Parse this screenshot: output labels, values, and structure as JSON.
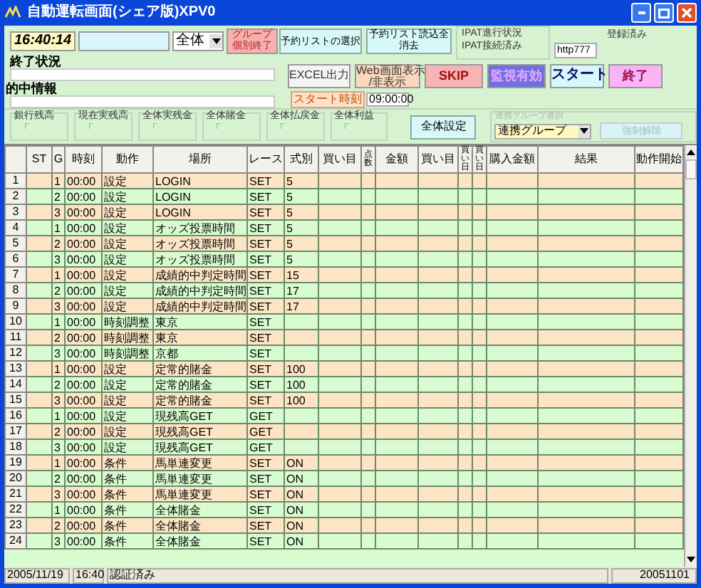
{
  "window": {
    "title": "自動運転画面(シェア版)XPV0"
  },
  "clock": "16:40:14",
  "group_select": {
    "value": "全体"
  },
  "group_end_button": "グループ個別終了",
  "end_status": {
    "label": "終了状況"
  },
  "hit_info": {
    "label": "的中情報"
  },
  "reserve_select_button": "予約リストの選択",
  "reserve_clear_button": "予約リスト読込全消去",
  "ipat": {
    "title": "IPAT進行状況",
    "status": "IPAT接続済み",
    "url": "http777"
  },
  "registered": "登録済み",
  "action_buttons": [
    {
      "label": "EXCEL出力",
      "kind": "plain"
    },
    {
      "label": "Web画面表示\n/非表示",
      "kind": "peach"
    },
    {
      "label": "SKIP",
      "kind": "pink"
    },
    {
      "label": "監視有効",
      "kind": "purple"
    },
    {
      "label": "スタート",
      "kind": "cyan"
    },
    {
      "label": "終了",
      "kind": "violet"
    }
  ],
  "start_time": {
    "label": "スタート時刻",
    "value": "09:00:00"
  },
  "totals": [
    {
      "label": "銀行残高",
      "value": "「"
    },
    {
      "label": "現在実残高",
      "value": "「"
    },
    {
      "label": "全体実残金",
      "value": "「"
    },
    {
      "label": "全体賭金",
      "value": "「"
    },
    {
      "label": "全体払戻金",
      "value": "「"
    },
    {
      "label": "全体利益",
      "value": "「"
    }
  ],
  "all_settings_button": "全体設定",
  "link_group": {
    "title": "連携グループ選択",
    "select": "連携グループ",
    "button": "強制解除",
    "disabled": true
  },
  "table": {
    "columns": [
      "ST",
      "G",
      "時刻",
      "動作",
      "場所",
      "レース",
      "式別",
      "買い目",
      "点数",
      "金額",
      "買い目",
      "買い日",
      "買い日",
      "購入金額",
      "結果",
      "動作開始"
    ],
    "rows": [
      {
        "header": "1",
        "cells": [
          "",
          "1",
          "00:00",
          "設定",
          "LOGIN",
          "SET",
          "5"
        ]
      },
      {
        "header": "2",
        "cells": [
          "",
          "2",
          "00:00",
          "設定",
          "LOGIN",
          "SET",
          "5"
        ]
      },
      {
        "header": "3",
        "cells": [
          "",
          "3",
          "00:00",
          "設定",
          "LOGIN",
          "SET",
          "5"
        ]
      },
      {
        "header": "4",
        "cells": [
          "",
          "1",
          "00:00",
          "設定",
          "オッズ投票時間",
          "SET",
          "5"
        ]
      },
      {
        "header": "5",
        "cells": [
          "",
          "2",
          "00:00",
          "設定",
          "オッズ投票時間",
          "SET",
          "5"
        ]
      },
      {
        "header": "6",
        "cells": [
          "",
          "3",
          "00:00",
          "設定",
          "オッズ投票時間",
          "SET",
          "5"
        ]
      },
      {
        "header": "7",
        "cells": [
          "",
          "1",
          "00:00",
          "設定",
          "成績的中判定時間",
          "SET",
          "15"
        ]
      },
      {
        "header": "8",
        "cells": [
          "",
          "2",
          "00:00",
          "設定",
          "成績的中判定時間",
          "SET",
          "17"
        ]
      },
      {
        "header": "9",
        "cells": [
          "",
          "3",
          "00:00",
          "設定",
          "成績的中判定時間",
          "SET",
          "17"
        ]
      },
      {
        "header": "10",
        "cells": [
          "",
          "1",
          "00:00",
          "時刻調整",
          "東京",
          "SET"
        ]
      },
      {
        "header": "11",
        "cells": [
          "",
          "2",
          "00:00",
          "時刻調整",
          "東京",
          "SET"
        ]
      },
      {
        "header": "12",
        "cells": [
          "",
          "3",
          "00:00",
          "時刻調整",
          "京都",
          "SET"
        ]
      },
      {
        "header": "13",
        "cells": [
          "",
          "1",
          "00:00",
          "設定",
          "定常的賭金",
          "SET",
          "100"
        ]
      },
      {
        "header": "14",
        "cells": [
          "",
          "2",
          "00:00",
          "設定",
          "定常的賭金",
          "SET",
          "100"
        ]
      },
      {
        "header": "15",
        "cells": [
          "",
          "3",
          "00:00",
          "設定",
          "定常的賭金",
          "SET",
          "100"
        ]
      },
      {
        "header": "16",
        "cells": [
          "",
          "1",
          "00:00",
          "設定",
          "現残高GET",
          "GET"
        ]
      },
      {
        "header": "17",
        "cells": [
          "",
          "2",
          "00:00",
          "設定",
          "現残高GET",
          "GET"
        ]
      },
      {
        "header": "18",
        "cells": [
          "",
          "3",
          "00:00",
          "設定",
          "現残高GET",
          "GET"
        ]
      },
      {
        "header": "19",
        "cells": [
          "",
          "1",
          "00:00",
          "条件",
          "馬単連変更",
          "SET",
          "ON"
        ]
      },
      {
        "header": "20",
        "cells": [
          "",
          "2",
          "00:00",
          "条件",
          "馬単連変更",
          "SET",
          "ON"
        ]
      },
      {
        "header": "21",
        "cells": [
          "",
          "3",
          "00:00",
          "条件",
          "馬単連変更",
          "SET",
          "ON"
        ]
      },
      {
        "header": "22",
        "cells": [
          "",
          "1",
          "00:00",
          "条件",
          "全体賭金",
          "SET",
          "ON"
        ]
      },
      {
        "header": "23",
        "cells": [
          "",
          "2",
          "00:00",
          "条件",
          "全体賭金",
          "SET",
          "ON"
        ]
      },
      {
        "header": "24",
        "cells": [
          "",
          "3",
          "00:00",
          "条件",
          "全体賭金",
          "SET",
          "ON"
        ]
      }
    ]
  },
  "status_bar": {
    "date": "2005/11/19",
    "time": "16:40",
    "state": "認証済み",
    "version": "20051101"
  }
}
